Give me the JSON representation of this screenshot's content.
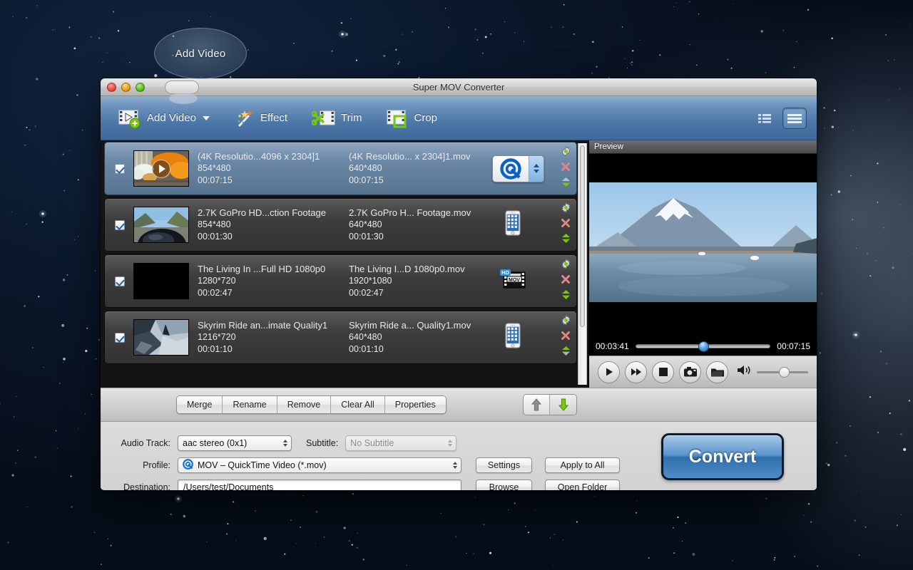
{
  "callout": {
    "label": "Add Video"
  },
  "window": {
    "title": "Super MOV Converter",
    "traffic": {
      "close": "close-button",
      "minimize": "minimize-button",
      "zoom": "zoom-button"
    }
  },
  "toolbar": {
    "items": [
      {
        "label": "Add Video",
        "icon": "add-video-icon",
        "has_caret": true
      },
      {
        "label": "Effect",
        "icon": "effect-wand-icon",
        "has_caret": false
      },
      {
        "label": "Trim",
        "icon": "trim-scissors-icon",
        "has_caret": false
      },
      {
        "label": "Crop",
        "icon": "crop-icon",
        "has_caret": false
      }
    ],
    "view_list": "list-view-button",
    "view_detail": "detail-view-button"
  },
  "list": {
    "rows": [
      {
        "checked": true,
        "selected": true,
        "source_name": "(4K Resolutio...4096 x 2304]1",
        "source_res": "854*480",
        "source_dur": "00:07:15",
        "output_name": "(4K Resolutio... x 2304]1.mov",
        "output_res": "640*480",
        "output_dur": "00:07:15",
        "format_icon": "quicktime-icon",
        "has_stepper": true,
        "thumb": "flowers",
        "play_overlay": true
      },
      {
        "checked": true,
        "selected": false,
        "source_name": "2.7K GoPro HD...ction Footage",
        "source_res": "854*480",
        "source_dur": "00:01:30",
        "output_name": "2.7K GoPro H... Footage.mov",
        "output_res": "640*480",
        "output_dur": "00:01:30",
        "format_icon": "iphone-icon",
        "has_stepper": false,
        "thumb": "gopro",
        "play_overlay": false
      },
      {
        "checked": true,
        "selected": false,
        "source_name": "The Living In ...Full HD 1080p0",
        "source_res": "1280*720",
        "source_dur": "00:02:47",
        "output_name": "The Living I...D 1080p0.mov",
        "output_res": "1920*1080",
        "output_dur": "00:02:47",
        "format_icon": "hd-mov-icon",
        "has_stepper": false,
        "thumb": "black",
        "play_overlay": false
      },
      {
        "checked": true,
        "selected": false,
        "source_name": "Skyrim Ride an...imate Quality1",
        "source_res": "1216*720",
        "source_dur": "00:01:10",
        "output_name": "Skyrim Ride a... Quality1.mov",
        "output_res": "640*480",
        "output_dur": "00:01:10",
        "format_icon": "iphone-icon",
        "has_stepper": false,
        "thumb": "skyrim",
        "play_overlay": false
      }
    ],
    "row_actions": {
      "settings": "gear-icon",
      "remove": "remove-x-icon",
      "reorder": "reorder-arrows-icon"
    }
  },
  "preview": {
    "header": "Preview",
    "current_time": "00:03:41",
    "total_time": "00:07:15",
    "seek_percent": 50,
    "volume_percent": 43,
    "controls": [
      {
        "name": "play-button",
        "icon": "play-icon"
      },
      {
        "name": "forward-button",
        "icon": "fast-forward-icon"
      },
      {
        "name": "stop-button",
        "icon": "stop-icon"
      },
      {
        "name": "snapshot-button",
        "icon": "camera-icon"
      },
      {
        "name": "open-folder-button",
        "icon": "folder-icon"
      }
    ],
    "volume_icon": "speaker-icon"
  },
  "mergebar": {
    "buttons": [
      "Merge",
      "Rename",
      "Remove",
      "Clear All",
      "Properties"
    ],
    "move_up": "move-up-button",
    "move_down": "move-down-button"
  },
  "settings": {
    "audio_track_label": "Audio Track:",
    "audio_track_value": "aac stereo (0x1)",
    "subtitle_label": "Subtitle:",
    "subtitle_value": "No Subtitle",
    "profile_label": "Profile:",
    "profile_value": "MOV – QuickTime Video (*.mov)",
    "profile_icon": "quicktime-icon",
    "destination_label": "Destination:",
    "destination_value": "/Users/test/Documents",
    "settings_button": "Settings",
    "apply_button": "Apply to All",
    "browse_button": "Browse",
    "open_folder_button": "Open Folder",
    "convert_button": "Convert"
  },
  "colors": {
    "toolbar_blue": "#4c76a6",
    "selection_blue": "#6b88a8",
    "convert_blue": "#2f6fae",
    "accent_green": "#7ac70c"
  }
}
